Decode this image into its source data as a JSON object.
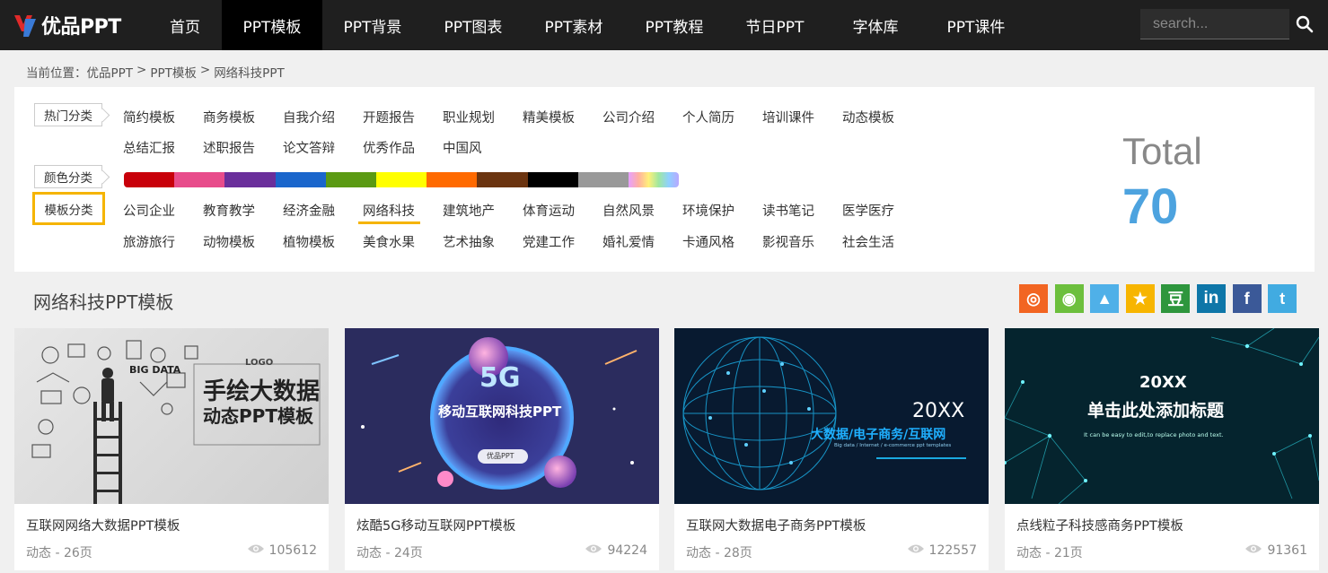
{
  "header": {
    "logo_text": "优品PPT",
    "nav": [
      {
        "label": "首页",
        "active": false
      },
      {
        "label": "PPT模板",
        "active": true
      },
      {
        "label": "PPT背景",
        "active": false
      },
      {
        "label": "PPT图表",
        "active": false
      },
      {
        "label": "PPT素材",
        "active": false
      },
      {
        "label": "PPT教程",
        "active": false
      },
      {
        "label": "节日PPT",
        "active": false
      },
      {
        "label": "字体库",
        "active": false
      },
      {
        "label": "PPT课件",
        "active": false
      }
    ],
    "search_placeholder": "search..."
  },
  "breadcrumb": {
    "prefix": "当前位置：",
    "items": [
      "优品PPT",
      "PPT模板",
      "网络科技PPT"
    ],
    "separator": ">"
  },
  "filters": {
    "hot_label": "热门分类",
    "hot_row1": [
      "简约模板",
      "商务模板",
      "自我介绍",
      "开题报告",
      "职业规划",
      "精美模板",
      "公司介绍",
      "个人简历",
      "培训课件",
      "动态模板"
    ],
    "hot_row2": [
      "总结汇报",
      "述职报告",
      "论文答辩",
      "优秀作品",
      "中国风"
    ],
    "color_label": "颜色分类",
    "colors": [
      "#c8000a",
      "#e84c8b",
      "#6a2f9b",
      "#1a66cc",
      "#5b9a13",
      "#ffff00",
      "#ff6a00",
      "#6b3410",
      "#000000",
      "#999999",
      "gradient"
    ],
    "template_label": "模板分类",
    "template_row1": [
      "公司企业",
      "教育教学",
      "经济金融",
      "网络科技",
      "建筑地产",
      "体育运动",
      "自然风景",
      "环境保护",
      "读书笔记",
      "医学医疗"
    ],
    "template_row2": [
      "旅游旅行",
      "动物模板",
      "植物模板",
      "美食水果",
      "艺术抽象",
      "党建工作",
      "婚礼爱情",
      "卡通风格",
      "影视音乐",
      "社会生活"
    ],
    "active_template": "网络科技"
  },
  "total": {
    "label": "Total",
    "value": "70"
  },
  "section": {
    "title": "网络科技PPT模板"
  },
  "share": [
    {
      "name": "weibo",
      "color": "#f26522",
      "glyph": "◎"
    },
    {
      "name": "wechat",
      "color": "#6cbf3d",
      "glyph": "◉"
    },
    {
      "name": "qq",
      "color": "#4fb0e8",
      "glyph": "▲"
    },
    {
      "name": "qzone",
      "color": "#f7b500",
      "glyph": "★"
    },
    {
      "name": "douban",
      "color": "#2e963d",
      "glyph": "豆"
    },
    {
      "name": "linkedin",
      "color": "#0e76a8",
      "glyph": "in"
    },
    {
      "name": "facebook",
      "color": "#3b5998",
      "glyph": "f"
    },
    {
      "name": "twitter",
      "color": "#41abe1",
      "glyph": "t"
    }
  ],
  "cards": [
    {
      "title": "互联网网络大数据PPT模板",
      "meta": "动态 - 26页",
      "views": "105612",
      "thumb": {
        "logo": "LOGO",
        "line1": "手绘大数据",
        "line2": "动态PPT模板",
        "tag": "BIG DATA"
      }
    },
    {
      "title": "炫酷5G移动互联网PPT模板",
      "meta": "动态 - 24页",
      "views": "94224",
      "thumb": {
        "big": "5G",
        "line1": "移动互联网科技PPT",
        "button": "优品PPT"
      }
    },
    {
      "title": "互联网大数据电子商务PPT模板",
      "meta": "动态 - 28页",
      "views": "122557",
      "thumb": {
        "year": "20XX",
        "line1": "大数据/电子商务/互联网",
        "sub": "Big data / Internet / e-commerce ppt templates"
      }
    },
    {
      "title": "点线粒子科技感商务PPT模板",
      "meta": "动态 - 21页",
      "views": "91361",
      "thumb": {
        "year": "20XX",
        "line1": "单击此处添加标题",
        "sub": "It can be easy to edit,to replace photo and text."
      }
    }
  ]
}
